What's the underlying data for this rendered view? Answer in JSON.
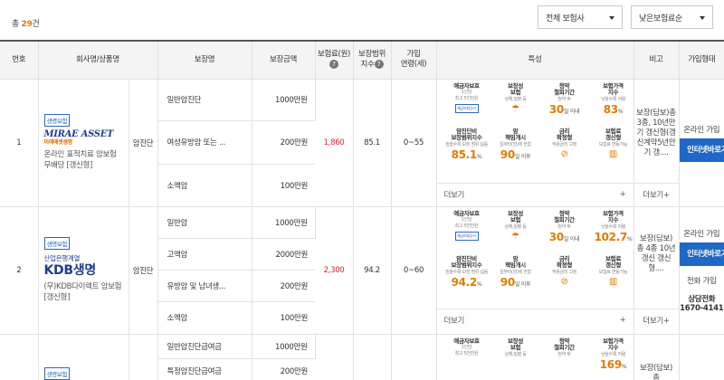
{
  "header": {
    "total_prefix": "총",
    "total_count": "29",
    "total_suffix": "건",
    "filter_insurer": "전체 보험사",
    "filter_sort": "낮은보험료순"
  },
  "columns": {
    "no": "번호",
    "company": "회사명/상품명",
    "coverage": "보장명",
    "amount": "보장금액",
    "premium_a": "보험료",
    "premium_b": "(원)",
    "scope_a": "보장범위",
    "scope_b": "지수",
    "period_a": "가입",
    "period_b": "연령",
    "period_c": "(세)",
    "feature": "특성",
    "note": "비고",
    "join": "가입형태"
  },
  "feature_labels": {
    "deposit_t1": "예금자보호",
    "deposit_t2": "1인당",
    "deposit_s": "최고 5천만원",
    "deposit_logo": "예금보험공사",
    "type_t1": "보장성",
    "type_t2": "보험",
    "type_s": "상해,질병 등",
    "cancel_t1": "청약",
    "cancel_t2": "철회기간",
    "cancel_s": "청약 후",
    "cancel_unit": "일 이내",
    "price_t1": "보험가격",
    "price_t2": "지수",
    "price_s": "낮을수록 저렴",
    "scope_t1": "암진단비",
    "scope_t2": "보장범위지수",
    "scope_s": "높을수록 보장 범위 넓음",
    "duty_t1": "암",
    "duty_t2": "책임개시",
    "duty_s": "일부터(암)에 한함",
    "duty_unit": "일 이후",
    "rate_t1": "금리",
    "rate_t2": "확정형",
    "rate_s": "적용금리 고정",
    "renew_t1": "보험료",
    "renew_t2": "갱신형",
    "renew_s": "보험료 변동가능",
    "more": "더보기",
    "note_more": "더보기"
  },
  "products": [
    {
      "no": "1",
      "badge": "생명보험",
      "brand": "MIRAE ASSET",
      "brand_sub": "미래에셋생명",
      "name": "온라인 표적치료 암보험 무배당 [갱신형]",
      "category": "암진단",
      "coverages": [
        {
          "name": "일반암진단",
          "amount": "1000만원"
        },
        {
          "name": "여성유방암 또는 ...",
          "amount": "200만원"
        },
        {
          "name": "소액암",
          "amount": "100만원"
        }
      ],
      "premium": "1,860",
      "scope": "85.1",
      "age": "0~55",
      "cancel_days": "30",
      "price_index": "83",
      "scope_index": "85.1",
      "duty_days": "90",
      "note": "보장(담보)총3종, 10년만기 갱신형(갱신계약5년만기 갱....",
      "join_type": "온라인 가입",
      "join_btn": "인터넷바로가입"
    },
    {
      "no": "2",
      "badge": "생명보험",
      "brand_top": "산업은행계열",
      "brand": "KDB생명",
      "name": "(무)KDB다이렉트 암보험 [갱신형]",
      "category": "암진단",
      "coverages": [
        {
          "name": "일반암",
          "amount": "1000만원"
        },
        {
          "name": "고액암",
          "amount": "2000만원"
        },
        {
          "name": "유방암 및 남녀생...",
          "amount": "200만원"
        },
        {
          "name": "소액암",
          "amount": "100만원"
        }
      ],
      "premium": "2,300",
      "scope": "94.2",
      "age": "0~60",
      "cancel_days": "30",
      "price_index": "102.7",
      "scope_index": "94.2",
      "duty_days": "90",
      "note": "보장(담보) 총 4종 10년 갱신 갱신형....",
      "join_type": "온라인 가입",
      "join_btn": "인터넷바로가입",
      "phone_label": "전화 가입",
      "phone_title": "상담전화",
      "phone_num": "1670-4141"
    },
    {
      "badge": "생명보험",
      "coverages": [
        {
          "name": "일반암진단급여금",
          "amount": "1000만원"
        },
        {
          "name": "특정암진단급여금",
          "amount": "200만원"
        }
      ],
      "price_index": "169",
      "note": "보장(담보) 총"
    }
  ]
}
